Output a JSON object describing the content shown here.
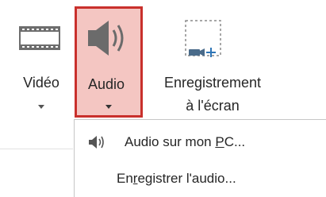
{
  "ribbon": {
    "video": {
      "label": "Vidéo",
      "icon": "film-strip-icon"
    },
    "audio": {
      "label": "Audio",
      "icon": "speaker-icon",
      "highlight_border": "#c9302c",
      "highlight_fill": "#f4c6c2"
    },
    "screen_recording": {
      "label_line1": "Enregistrement",
      "label_line2": "à l'écran",
      "icon": "screen-record-icon"
    }
  },
  "menu": {
    "items": [
      {
        "label_pre": "Audio sur mon ",
        "label_underline": "P",
        "label_post": "C...",
        "icon": "speaker-small-icon"
      },
      {
        "label_pre": "En",
        "label_underline": "r",
        "label_post": "egistrer l'audio...",
        "icon": ""
      }
    ]
  }
}
